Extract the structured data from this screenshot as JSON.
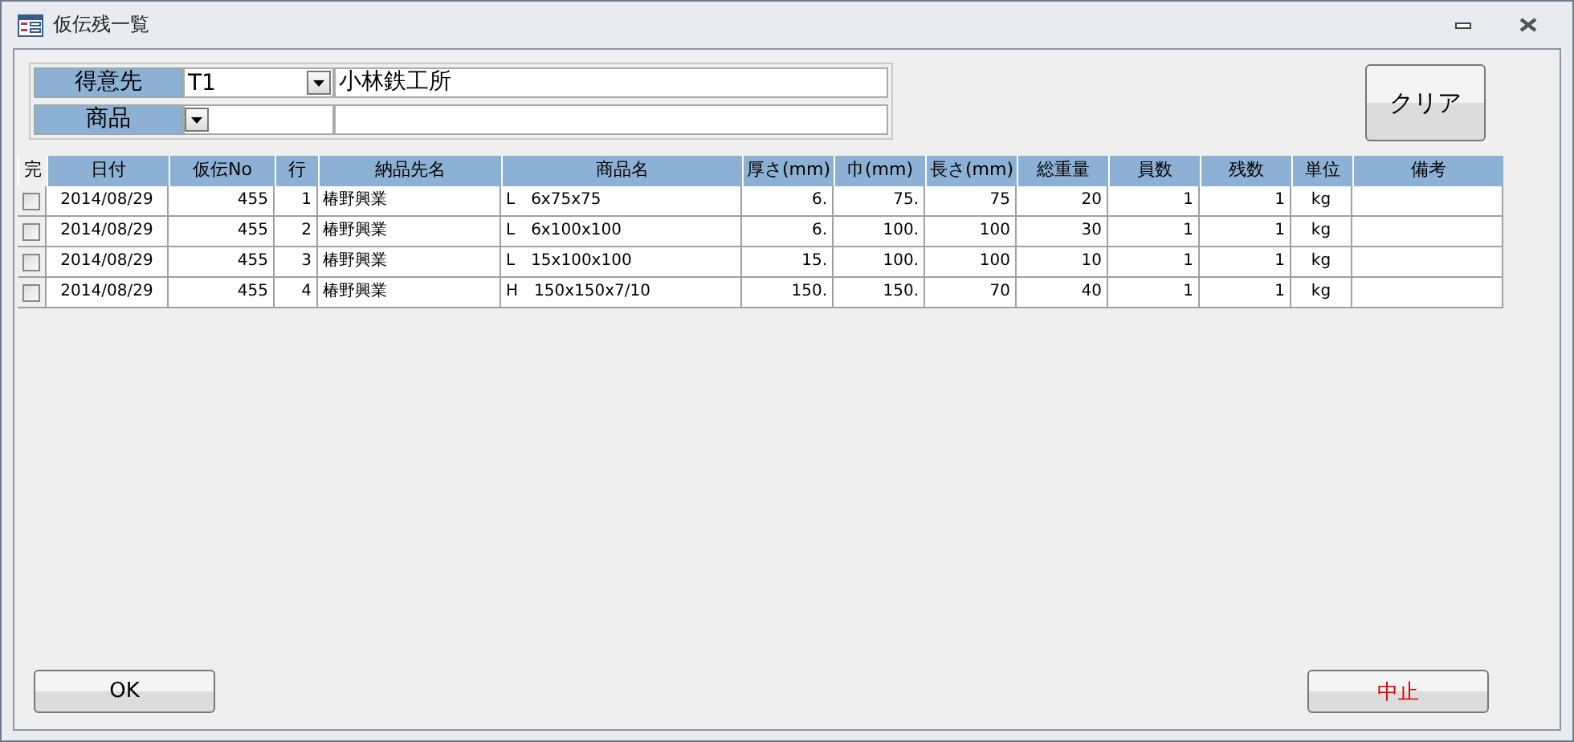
{
  "window": {
    "title": "仮伝残一覧"
  },
  "filters": [
    {
      "label": "得意先",
      "code": "T1",
      "name": "小林鉄工所"
    },
    {
      "label": "商品"
    }
  ],
  "clear_button": "クリア",
  "table": {
    "check_column": "完",
    "columns": [
      "日付",
      "仮伝No",
      "行",
      "納品先名",
      "商品名",
      "厚さ(mm)",
      "巾(mm)",
      "長さ(mm)",
      "総重量",
      "員数",
      "残数",
      "単位",
      "備考"
    ],
    "rows": [
      {
        "checked": false,
        "cells": [
          "2014/08/29",
          "455",
          "1",
          "椿野興業",
          "L　6x75x75",
          "6.",
          "75.",
          "75",
          "20",
          "1",
          "1",
          "kg"
        ]
      },
      {
        "checked": false,
        "cells": [
          "2014/08/29",
          "455",
          "2",
          "椿野興業",
          "L　6x100x100",
          "6.",
          "100.",
          "100",
          "30",
          "1",
          "1",
          "kg"
        ]
      },
      {
        "checked": false,
        "cells": [
          "2014/08/29",
          "455",
          "3",
          "椿野興業",
          "L　15x100x100",
          "15.",
          "100.",
          "100",
          "10",
          "1",
          "1",
          "kg"
        ]
      },
      {
        "checked": false,
        "cells": [
          "2014/08/29",
          "455",
          "4",
          "椿野興業",
          "H　150x150x7/10",
          "150.",
          "150.",
          "70",
          "40",
          "1",
          "1",
          "kg"
        ]
      }
    ]
  },
  "buttons": {
    "ok": "OK",
    "cancel": "中止"
  }
}
